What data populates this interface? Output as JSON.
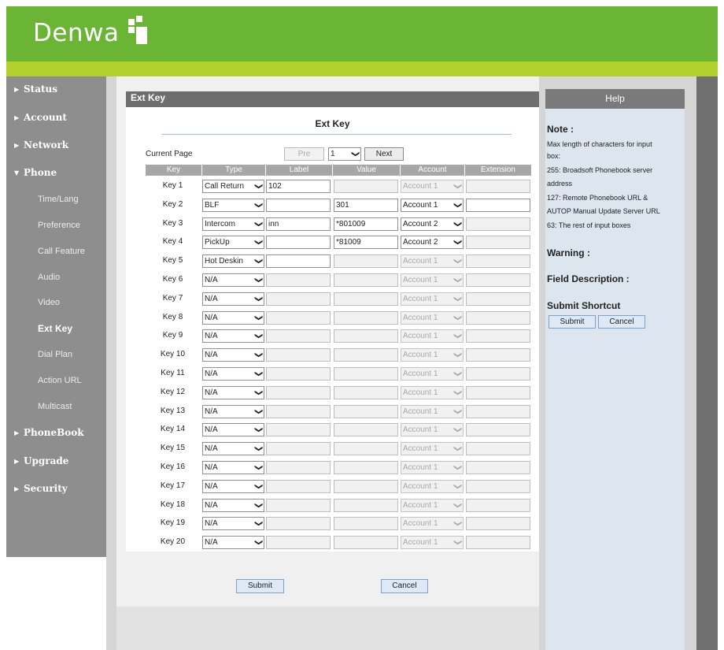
{
  "brand": {
    "name": "Denwa"
  },
  "nav": {
    "status": "Status",
    "account": "Account",
    "network": "Network",
    "phone": "Phone",
    "phone_items": [
      "Time/Lang",
      "Preference",
      "Call Feature",
      "Audio",
      "Video",
      "Ext Key",
      "Dial Plan",
      "Action URL",
      "Multicast"
    ],
    "phonebook": "PhoneBook",
    "upgrade": "Upgrade",
    "security": "Security"
  },
  "page": {
    "section_title": "Ext Key",
    "panel_title": "Ext Key",
    "current_page_label": "Current Page",
    "pre_label": "Pre",
    "page_value": "1",
    "next_label": "Next",
    "submit_label": "Submit",
    "cancel_label": "Cancel"
  },
  "table": {
    "headers": [
      "Key",
      "Type",
      "Label",
      "Value",
      "Account",
      "Extension"
    ],
    "rows": [
      {
        "key": "Key 1",
        "type": "Call Return",
        "label": "102",
        "value": "",
        "account": "Account 1"
      },
      {
        "key": "Key 2",
        "type": "BLF",
        "label": "",
        "value": "301",
        "account": "Account 1"
      },
      {
        "key": "Key 3",
        "type": "Intercom",
        "label": "inn",
        "value": "*801009",
        "account": "Account 2"
      },
      {
        "key": "Key 4",
        "type": "PickUp",
        "label": "",
        "value": "*81009",
        "account": "Account 2"
      },
      {
        "key": "Key 5",
        "type": "Hot Deskin",
        "label": "",
        "value": "",
        "account": "Account 1"
      },
      {
        "key": "Key 6",
        "type": "N/A",
        "label": "",
        "value": "",
        "account": "Account 1"
      },
      {
        "key": "Key 7",
        "type": "N/A",
        "label": "",
        "value": "",
        "account": "Account 1"
      },
      {
        "key": "Key 8",
        "type": "N/A",
        "label": "",
        "value": "",
        "account": "Account 1"
      },
      {
        "key": "Key 9",
        "type": "N/A",
        "label": "",
        "value": "",
        "account": "Account 1"
      },
      {
        "key": "Key 10",
        "type": "N/A",
        "label": "",
        "value": "",
        "account": "Account 1"
      },
      {
        "key": "Key 11",
        "type": "N/A",
        "label": "",
        "value": "",
        "account": "Account 1"
      },
      {
        "key": "Key 12",
        "type": "N/A",
        "label": "",
        "value": "",
        "account": "Account 1"
      },
      {
        "key": "Key 13",
        "type": "N/A",
        "label": "",
        "value": "",
        "account": "Account 1"
      },
      {
        "key": "Key 14",
        "type": "N/A",
        "label": "",
        "value": "",
        "account": "Account 1"
      },
      {
        "key": "Key 15",
        "type": "N/A",
        "label": "",
        "value": "",
        "account": "Account 1"
      },
      {
        "key": "Key 16",
        "type": "N/A",
        "label": "",
        "value": "",
        "account": "Account 1"
      },
      {
        "key": "Key 17",
        "type": "N/A",
        "label": "",
        "value": "",
        "account": "Account 1"
      },
      {
        "key": "Key 18",
        "type": "N/A",
        "label": "",
        "value": "",
        "account": "Account 1"
      },
      {
        "key": "Key 19",
        "type": "N/A",
        "label": "",
        "value": "",
        "account": "Account 1"
      },
      {
        "key": "Key 20",
        "type": "N/A",
        "label": "",
        "value": "",
        "account": "Account 1"
      }
    ]
  },
  "help": {
    "title": "Help",
    "note_heading": "Note :",
    "note_lines": [
      "Max length of characters for input",
      "box:",
      "255: Broadsoft Phonebook server",
      "address",
      "127: Remote Phonebook URL &",
      "AUTOP Manual Update Server URL",
      "63: The rest of input boxes"
    ],
    "warning_heading": "Warning :",
    "field_heading": "Field Description :",
    "shortcut_heading": "Submit Shortcut",
    "submit_label": "Submit",
    "cancel_label": "Cancel"
  },
  "colors": {
    "header_green": "#6bb535",
    "strip_lime": "#b2cf2c",
    "sidebar_gray": "#8e8e8e",
    "help_blue": "#dde5ef"
  }
}
